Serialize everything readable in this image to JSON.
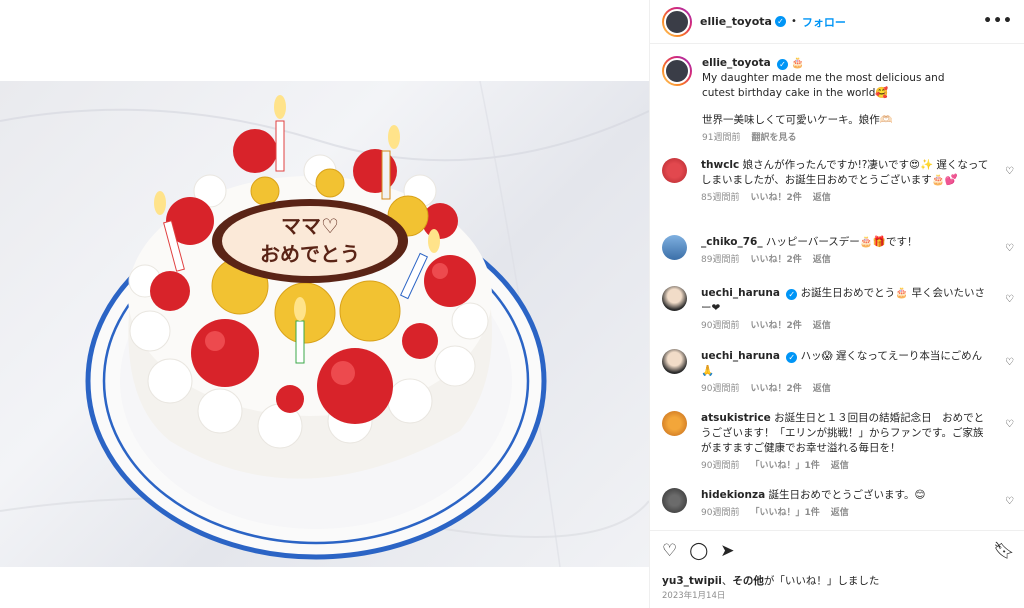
{
  "post": {
    "author": "ellie_toyota",
    "follow_label": "フォロー",
    "more_label": "•••",
    "caption_emoji": "🎂",
    "caption_line1": "My daughter made me the most delicious and cutest birthday cake in the world🥰",
    "caption_line2": "世界一美味しくて可愛いケーキ。娘作🫶🏻",
    "caption_time": "91週間前",
    "caption_translate": "翻訳を見る",
    "plaque_text": "ママ♡おめでとう"
  },
  "comments": [
    {
      "user": "thwclc",
      "verified": false,
      "text": "娘さんが作ったんですか!?凄いです😍✨ 遅くなってしまいましたが、お誕生日おめでとうございます🎂💕",
      "time": "85週間前",
      "likes": "いいね！2件",
      "reply": "返信"
    },
    {
      "user": "_chiko_76_",
      "verified": false,
      "text": "ハッピーバースデー🎂🎁です！",
      "time": "89週間前",
      "likes": "いいね！2件",
      "reply": "返信"
    },
    {
      "user": "uechi_haruna",
      "verified": true,
      "text": "お誕生日おめでとう🎂 早く会いたいさー❤",
      "time": "90週間前",
      "likes": "いいね！2件",
      "reply": "返信"
    },
    {
      "user": "uechi_haruna",
      "verified": true,
      "text": "ハッ😱 遅くなってえーり本当にごめん🙏",
      "time": "90週間前",
      "likes": "いいね！2件",
      "reply": "返信"
    },
    {
      "user": "atsukistrice",
      "verified": false,
      "text": "お誕生日と１３回目の結婚記念日　おめでとうございます！「エリンが挑戦！」からファンです。ご家族がますますご健康でお幸せ溢れる毎日を！",
      "time": "90週間前",
      "likes": "「いいね！」1件",
      "reply": "返信"
    },
    {
      "user": "hidekionza",
      "verified": false,
      "text": "誕生日おめでとうございます。😊",
      "time": "90週間前",
      "likes": "「いいね！」1件",
      "reply": "返信"
    }
  ],
  "footer": {
    "liker": "yu3_twipii",
    "liker_suffix": "、",
    "others": "その他",
    "liked_text": "が「いいね！」しました",
    "date": "2023年1月14日"
  },
  "icons": {
    "heart": "heart-icon",
    "comment": "comment-icon",
    "share": "share-icon",
    "bookmark": "bookmark-icon"
  }
}
